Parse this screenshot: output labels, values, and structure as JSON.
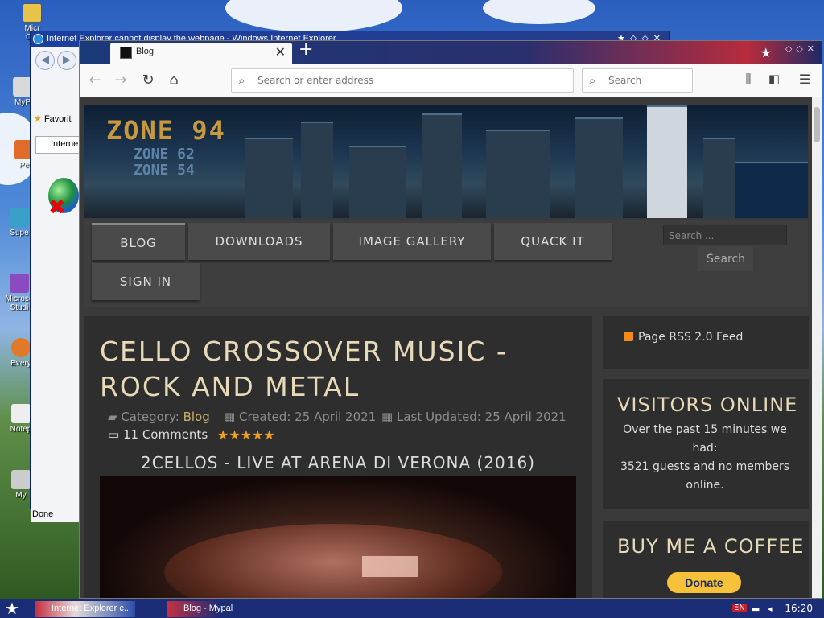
{
  "desktop": {
    "icons": [
      {
        "label": "Micr\nOut"
      },
      {
        "label": "MyP"
      },
      {
        "label": "Pe"
      },
      {
        "label": "Supe"
      },
      {
        "label": "Microso\nStudi"
      },
      {
        "label": "Every"
      },
      {
        "label": "Notep"
      },
      {
        "label": "My"
      }
    ]
  },
  "ie_window": {
    "title": "Internet Explorer cannot display the webpage - Windows Internet Explorer",
    "favorites_label": "Favorit",
    "tab_label": "Interne",
    "status_text": "Done"
  },
  "firefox": {
    "tab_title": "Blog",
    "url_placeholder": "Search or enter address",
    "search_placeholder": "Search"
  },
  "site": {
    "logo": {
      "main": "ZONE 94",
      "sub1": "ZONE 62",
      "sub2": "ZONE 54"
    },
    "menu": [
      "BLOG",
      "DOWNLOADS",
      "IMAGE GALLERY",
      "QUACK IT",
      "SIGN IN"
    ],
    "search_placeholder": "Search ...",
    "search_button": "Search",
    "article": {
      "title": "CELLO CROSSOVER MUSIC - ROCK AND METAL",
      "category_label": "Category:",
      "category_value": "Blog",
      "created": "Created: 25 April 2021",
      "updated": "Last Updated: 25 April 2021",
      "comments": "11 Comments",
      "rating_stars": 5,
      "video_title": "2CELLOS - LIVE AT ARENA DI VERONA (2016)"
    },
    "sidebar": {
      "rss": "Page RSS 2.0 Feed",
      "visitors_title": "VISITORS ONLINE",
      "visitors_text1": "Over the past 15 minutes we had:",
      "visitors_text2": "3521 guests and no members online.",
      "coffee_title": "BUY ME A COFFEE",
      "donate_label": "Donate"
    }
  },
  "taskbar": {
    "task1": "Internet Explorer c...",
    "task2": "Blog - Mypal",
    "lang": "EN",
    "clock": "16:20"
  },
  "colors": {
    "accent_gold": "#e8d9b8",
    "star_orange": "#f0a020",
    "donate_yellow": "#f7c23a"
  }
}
